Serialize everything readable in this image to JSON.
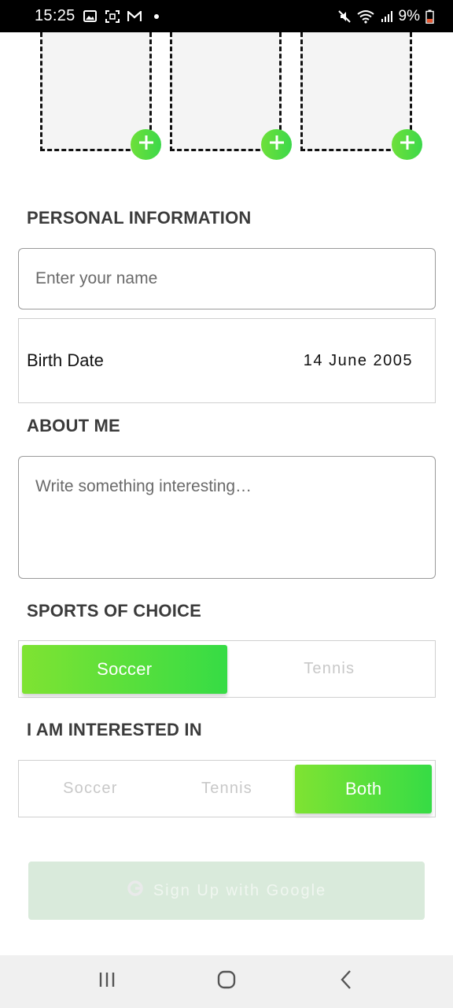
{
  "status_bar": {
    "time": "15:25",
    "battery": "9%",
    "icons": [
      "gallery-icon",
      "screenshot-icon",
      "gmail-icon",
      "dot-icon",
      "mute-icon",
      "wifi-icon",
      "signal-icon",
      "battery-icon"
    ]
  },
  "photos": {
    "tiles": [
      "photo-slot-1",
      "photo-slot-2",
      "photo-slot-3"
    ],
    "add_icon": "plus-icon"
  },
  "personal_info": {
    "title": "PERSONAL INFORMATION",
    "name_placeholder": "Enter your name",
    "birth_label": "Birth Date",
    "birth_value": "14 June 2005"
  },
  "about": {
    "title": "ABOUT ME",
    "placeholder": "Write something interesting…"
  },
  "sports": {
    "title": "SPORTS OF CHOICE",
    "options": [
      "Soccer",
      "Tennis"
    ],
    "selected": "Soccer"
  },
  "interested": {
    "title": "I AM INTERESTED IN",
    "options": [
      "Soccer",
      "Tennis",
      "Both"
    ],
    "selected": "Both"
  },
  "signup": {
    "label": "Sign Up with Google",
    "icon": "google-icon"
  },
  "colors": {
    "accent_start": "#7fe332",
    "accent_end": "#36dc45",
    "signup_bg": "#d9eadb"
  }
}
